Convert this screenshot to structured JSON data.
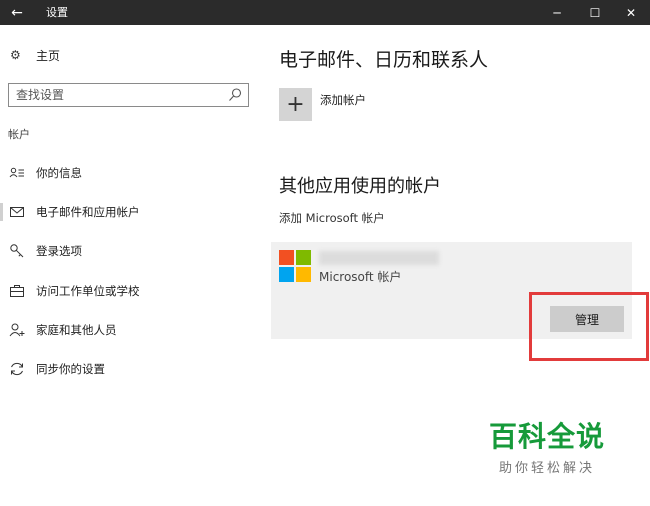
{
  "window": {
    "title": "设置",
    "back_icon": "←",
    "minimize_icon": "─",
    "maximize_icon": "☐",
    "close_icon": "✕"
  },
  "sidebar": {
    "home_label": "主页",
    "home_icon": "⚙",
    "search_placeholder": "查找设置",
    "section_label": "帐户",
    "items": [
      {
        "label": "你的信息",
        "icon": "user-card-icon",
        "selected": false
      },
      {
        "label": "电子邮件和应用帐户",
        "icon": "mail-icon",
        "selected": true
      },
      {
        "label": "登录选项",
        "icon": "key-icon",
        "selected": false
      },
      {
        "label": "访问工作单位或学校",
        "icon": "briefcase-icon",
        "selected": false
      },
      {
        "label": "家庭和其他人员",
        "icon": "person-add-icon",
        "selected": false
      },
      {
        "label": "同步你的设置",
        "icon": "sync-icon",
        "selected": false
      }
    ]
  },
  "main": {
    "email_heading": "电子邮件、日历和联系人",
    "add_account_icon": "+",
    "add_account_label": "添加帐户",
    "other_apps_heading": "其他应用使用的帐户",
    "add_ms_account_label": "添加 Microsoft 帐户",
    "account": {
      "type_label": "Microsoft 帐户",
      "manage_label": "管理"
    }
  },
  "colors": {
    "titlebar": "#2b2b2b",
    "card": "#f0f0f0",
    "manage_button": "#cccccc",
    "highlight": "#e23b3b",
    "ms_red": "#f25022",
    "ms_green": "#7fba00",
    "ms_blue": "#00a4ef",
    "ms_yellow": "#ffb900"
  },
  "watermark": {
    "main": "百科全说",
    "sub": "助你轻松解决"
  }
}
